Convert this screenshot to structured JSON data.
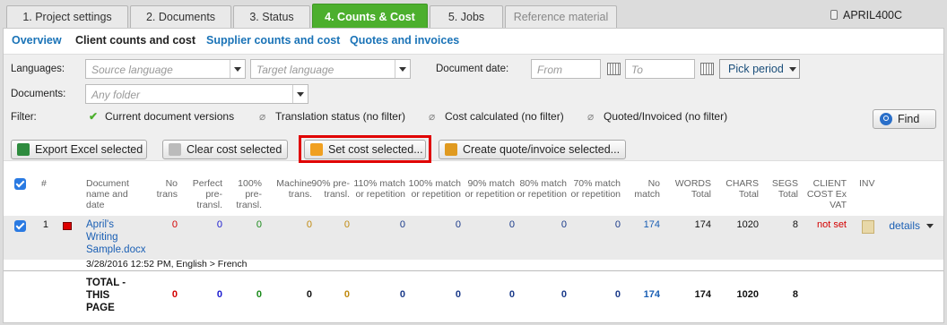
{
  "tabs": [
    "1. Project settings",
    "2. Documents",
    "3. Status",
    "4. Counts & Cost",
    "5. Jobs",
    "Reference material"
  ],
  "project_code": "APRIL400C",
  "subnav": [
    "Overview",
    "Client counts and cost",
    "Supplier counts and cost",
    "Quotes and invoices"
  ],
  "filters": {
    "languages_label": "Languages:",
    "source_placeholder": "Source language",
    "target_placeholder": "Target language",
    "docdate_label": "Document date:",
    "from_placeholder": "From",
    "to_placeholder": "To",
    "pick_period": "Pick period",
    "documents_label": "Documents:",
    "folder_placeholder": "Any folder",
    "filter_label": "Filter:",
    "current_versions": "Current document versions",
    "translation_status": "Translation status (no filter)",
    "cost_calculated": "Cost calculated (no filter)",
    "quoted_invoiced": "Quoted/Invoiced (no filter)",
    "find": "Find"
  },
  "toolbar": {
    "export": "Export Excel selected",
    "clear": "Clear cost selected",
    "set": "Set cost selected...",
    "create": "Create quote/invoice selected..."
  },
  "columns": {
    "num": "#",
    "doc": "Document name and date",
    "no_trans": "No trans",
    "perfect": "Perfect pre-transl.",
    "p100": "100% pre-transl.",
    "machine": "Machine trans.",
    "p90": "90% pre-transl.",
    "m110": "110% match or repetition",
    "m100": "100% match or repetition",
    "m90": "90% match or repetition",
    "m80": "80% match or repetition",
    "m70": "70% match or repetition",
    "nomatch": "No match",
    "words": "WORDS Total",
    "chars": "CHARS Total",
    "segs": "SEGS Total",
    "cost": "CLIENT COST Ex VAT",
    "inv": "INV"
  },
  "row": {
    "index": "1",
    "doc_name": "April's Writing Sample.docx",
    "doc_meta": "3/28/2016 12:52 PM, English > French",
    "values": [
      "0",
      "0",
      "0",
      "0",
      "0",
      "0",
      "0",
      "0",
      "0",
      "0",
      "174",
      "174",
      "1020",
      "8"
    ],
    "cost": "not set",
    "details": "details"
  },
  "totals": {
    "label": "TOTAL - THIS PAGE",
    "values": [
      "0",
      "0",
      "0",
      "0",
      "0",
      "0",
      "0",
      "0",
      "0",
      "0",
      "174",
      "174",
      "1020",
      "8"
    ]
  }
}
